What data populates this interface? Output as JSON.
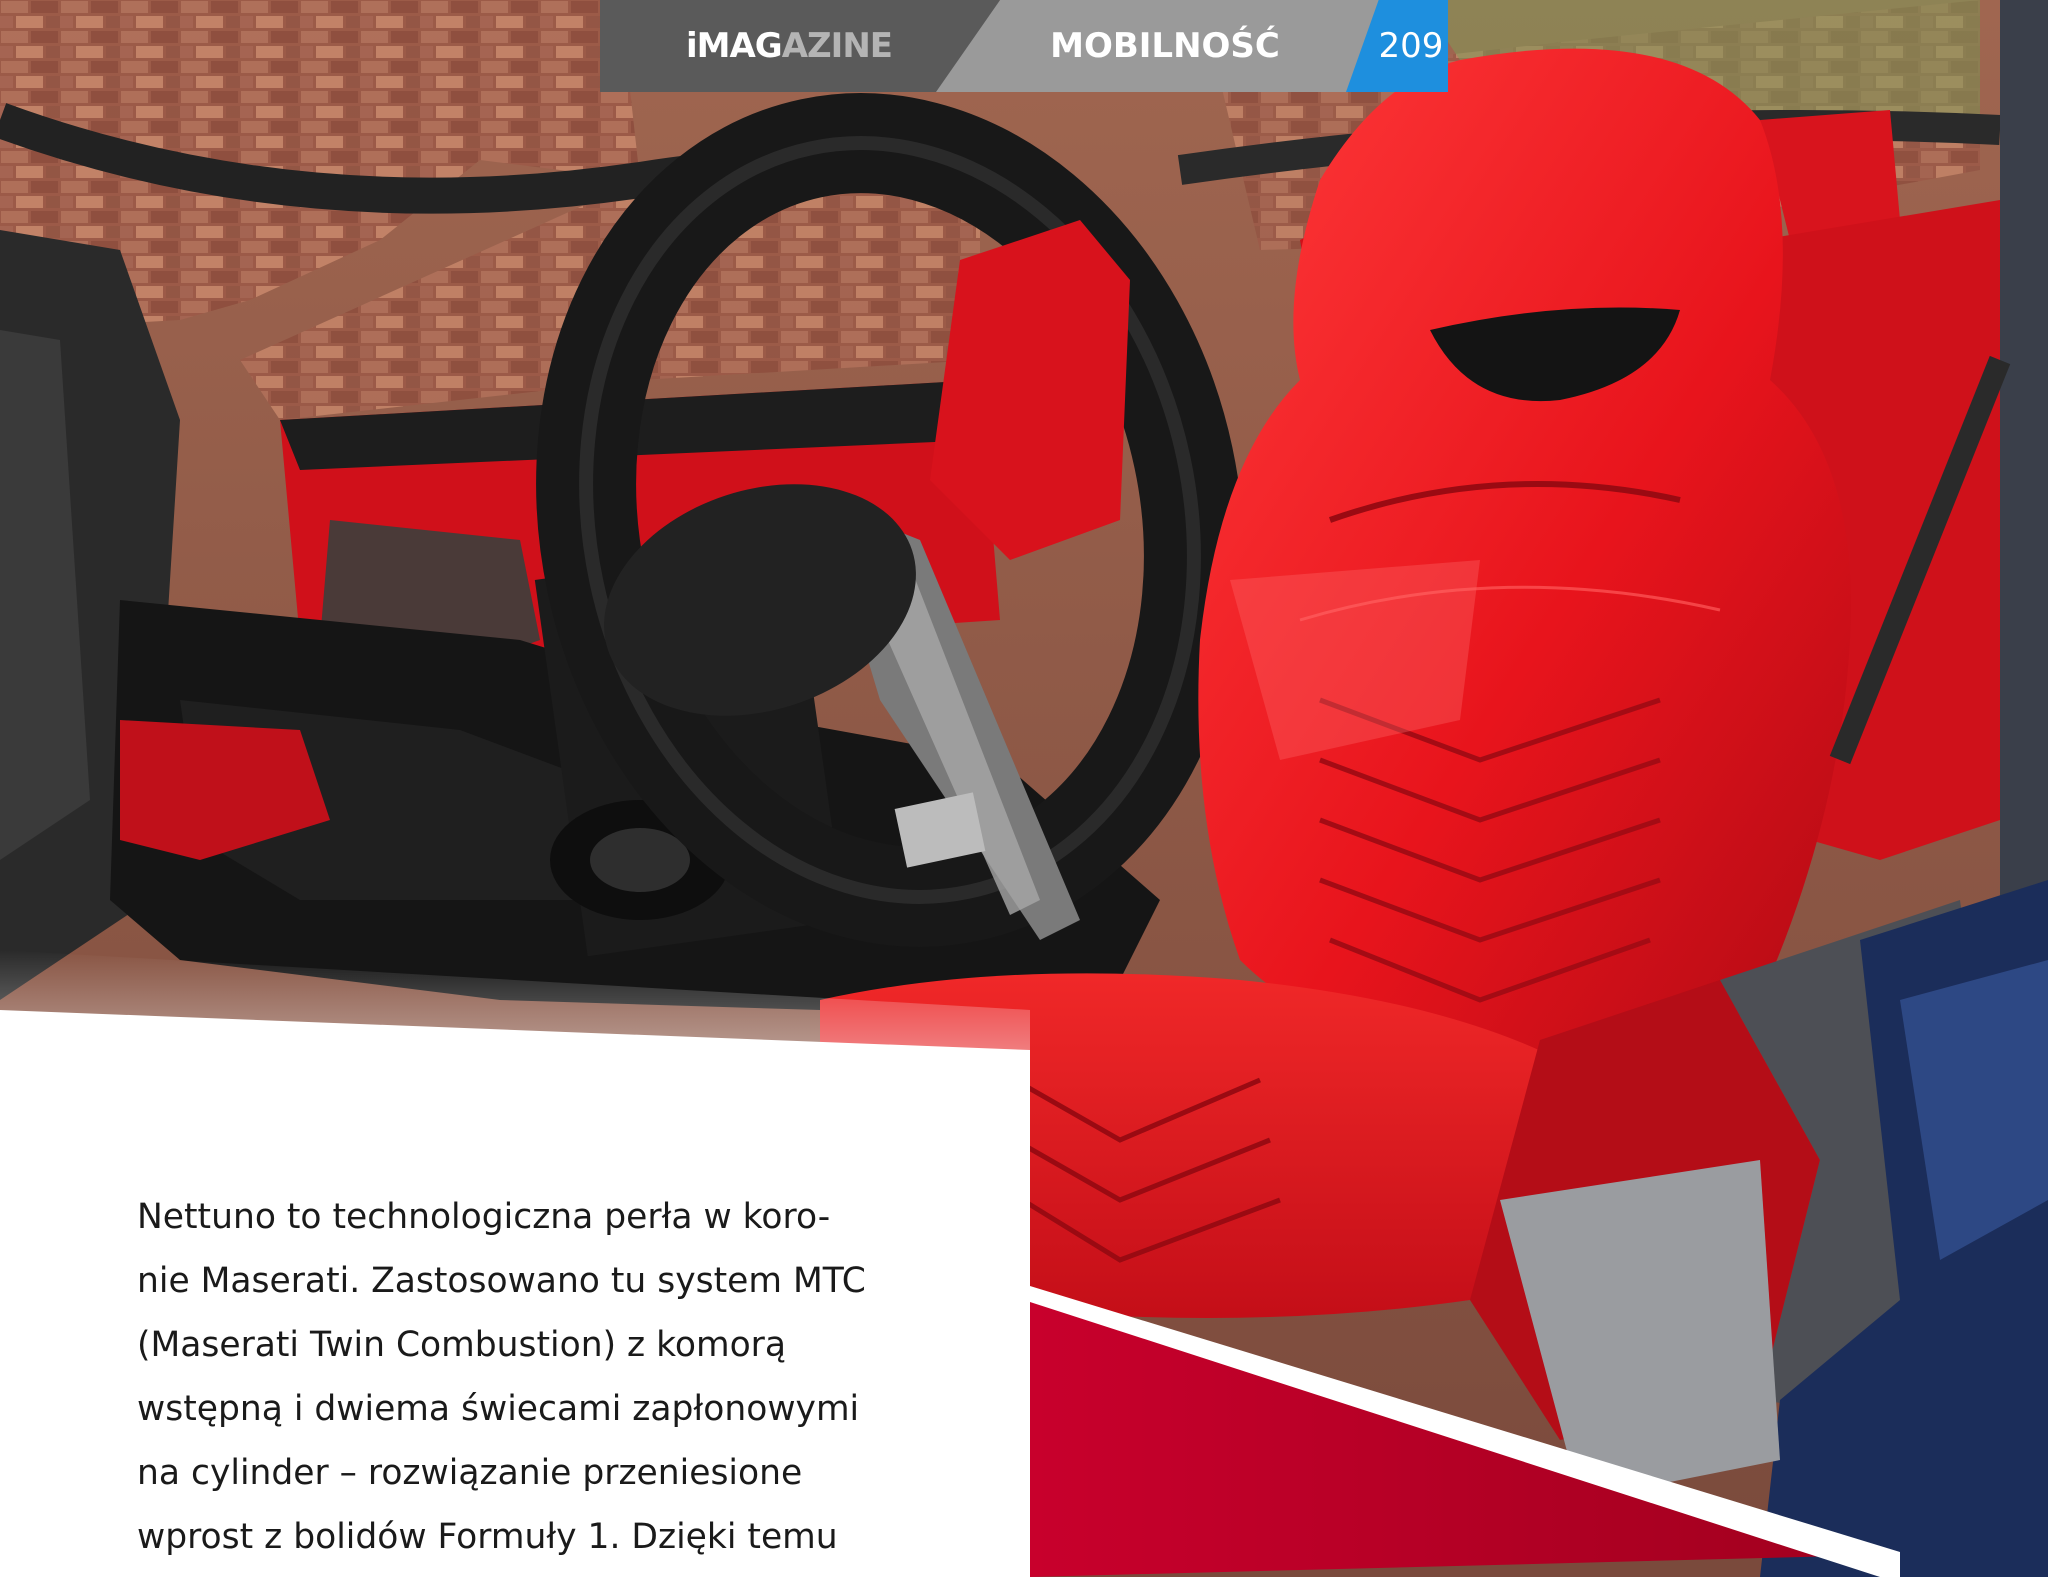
{
  "header": {
    "logo_main": "iMAG",
    "logo_rest": "AZINE",
    "section": "MOBILNOŚĆ",
    "page_number": "209"
  },
  "colors": {
    "leather_red": "#e8141c",
    "accent_crimson": "#c8002c",
    "page_tab_blue": "#1e8fde",
    "header_dark_gray": "#5a5a5a",
    "header_light_gray": "#9a9a9a"
  },
  "body": {
    "lines": [
      "Nettuno to technologiczna perła w koro-",
      "nie Maserati. Zastosowano tu system MTC",
      "(Maserati Twin Combustion) z komorą",
      "wstępną i dwiema świecami zapłonowymi",
      "na cylinder – rozwiązanie przeniesione",
      "wprost z bolidów Formuły 1. Dzięki temu"
    ]
  }
}
